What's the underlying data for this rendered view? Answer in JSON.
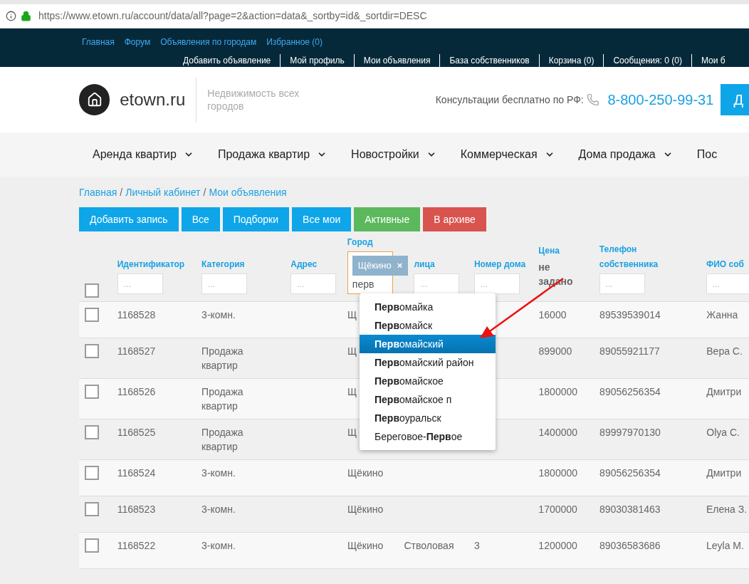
{
  "browser": {
    "url": "https://www.etown.ru/account/data/all?page=2&action=data&_sortby=id&_sortdir=DESC"
  },
  "top_nav": {
    "primary": [
      "Главная",
      "Форум",
      "Объявления по городам",
      "Избранное (0)"
    ],
    "secondary": [
      "Добавить объявление",
      "Мой профиль",
      "Мои объявления",
      "База собственников",
      "Корзина (0)",
      "Сообщения: 0 (0)",
      "Мои б"
    ]
  },
  "header": {
    "logo_text": "etown.ru",
    "tagline": "Недвижимость всех городов",
    "consult_label": "Консультации бесплатно по РФ:",
    "phone": "8-800-250-99-31",
    "button": "Д"
  },
  "menu": [
    "Аренда квартир",
    "Продажа квартир",
    "Новостройки",
    "Коммерческая",
    "Дома продажа",
    "Пос"
  ],
  "breadcrumb": {
    "separator": "/",
    "items": [
      "Главная",
      "Личный кабинет",
      "Мои объявления"
    ]
  },
  "actions": [
    {
      "label": "Добавить запись",
      "kind": "primary"
    },
    {
      "label": "Все",
      "kind": "primary"
    },
    {
      "label": "Подборки",
      "kind": "primary"
    },
    {
      "label": "Все мои",
      "kind": "primary"
    },
    {
      "label": "Активные",
      "kind": "success"
    },
    {
      "label": "В архиве",
      "kind": "danger"
    }
  ],
  "table": {
    "select_all_checked": false,
    "columns": [
      {
        "label": "Идентификатор",
        "kind": "filter",
        "placeholder": "..."
      },
      {
        "label": "Категория",
        "kind": "filter",
        "placeholder": "..."
      },
      {
        "label": "Адрес",
        "kind": "filter",
        "placeholder": "..."
      },
      {
        "label": "Город",
        "kind": "tags",
        "tag": "Щёкино",
        "tag_remove": "×",
        "value": "перв"
      },
      {
        "label": "лица",
        "kind": "filter",
        "placeholder": "..."
      },
      {
        "label": "Номер дома",
        "kind": "filter",
        "placeholder": "..."
      },
      {
        "label": "Цена",
        "kind": "note",
        "note": "не задано"
      },
      {
        "label": "Телефон собственника",
        "kind": "filter",
        "placeholder": "..."
      },
      {
        "label": "ФИО соб",
        "kind": "filter",
        "placeholder": "..."
      }
    ],
    "rows": [
      {
        "checked": false,
        "cells": [
          "1168528",
          "3-комн.",
          "",
          "Щ",
          "",
          "",
          "16000",
          "89539539014",
          "Жанна"
        ]
      },
      {
        "checked": false,
        "cells": [
          "1168527",
          "Продажа квартир",
          "",
          "Щ",
          "",
          "",
          "899000",
          "89055921177",
          "Вера С."
        ]
      },
      {
        "checked": false,
        "cells": [
          "1168526",
          "Продажа квартир",
          "",
          "Щ",
          "",
          "",
          "1800000",
          "89056256354",
          "Дмитри"
        ]
      },
      {
        "checked": false,
        "cells": [
          "1168525",
          "Продажа квартир",
          "",
          "Щ",
          "",
          "",
          "1400000",
          "89997970130",
          "Olya C."
        ]
      },
      {
        "checked": false,
        "cells": [
          "1168524",
          "3-комн.",
          "",
          "Щёкино",
          "",
          "",
          "1800000",
          "89056256354",
          "Дмитри"
        ]
      },
      {
        "checked": false,
        "cells": [
          "1168523",
          "3-комн.",
          "",
          "Щёкино",
          "",
          "",
          "1700000",
          "89030381463",
          "Елена З."
        ]
      },
      {
        "checked": false,
        "cells": [
          "1168522",
          "3-комн.",
          "",
          "Щёкино",
          "Стволовая",
          "3",
          "1200000",
          "89036583686",
          "Leyla M."
        ]
      }
    ]
  },
  "suggestions": [
    {
      "label": "**Перв**омайка",
      "selected": false
    },
    {
      "label": "**Перв**омайск",
      "selected": false
    },
    {
      "label": "**Перв**омайский",
      "selected": true
    },
    {
      "label": "**Перв**омайский район",
      "selected": false
    },
    {
      "label": "**Перв**омайское",
      "selected": false
    },
    {
      "label": "**Перв**омайское п",
      "selected": false
    },
    {
      "label": "**Перв**оуральск",
      "selected": false
    },
    {
      "label": "Береговое-**Перв**ое",
      "selected": false
    }
  ]
}
